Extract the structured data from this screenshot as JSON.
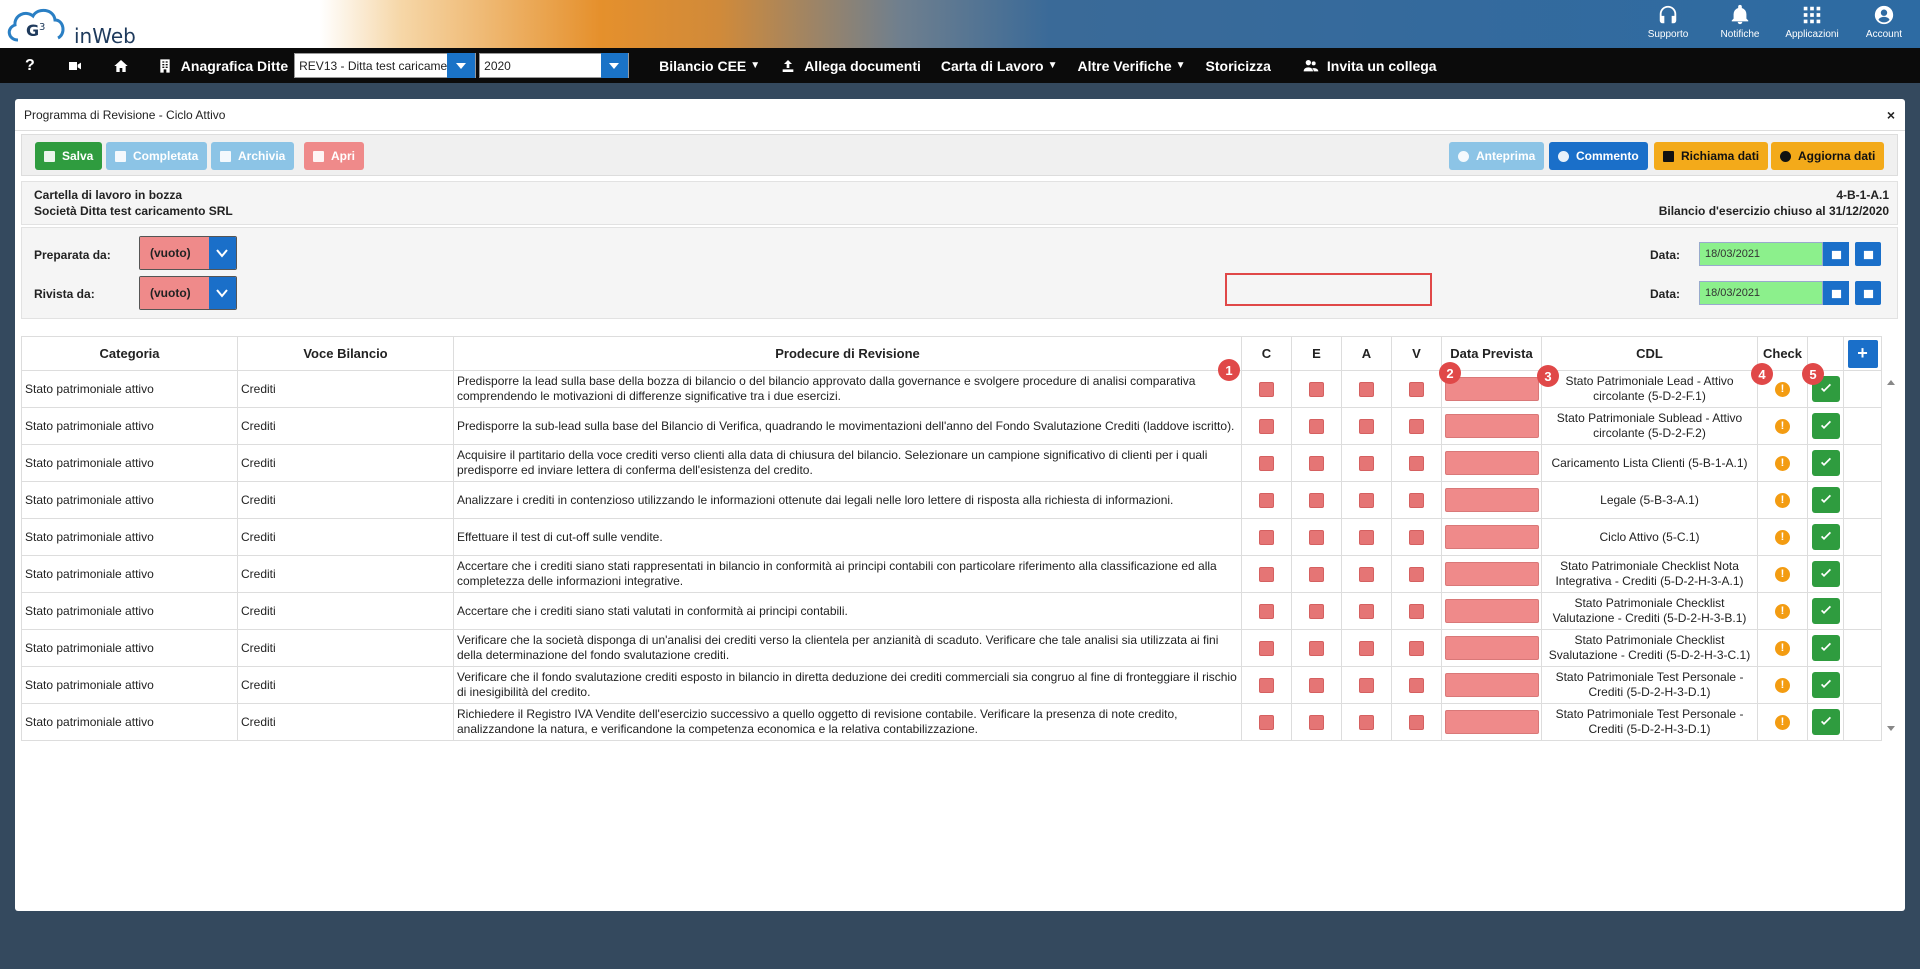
{
  "app": {
    "logo_text": "inWeb"
  },
  "top_icons": [
    {
      "label": "Supporto",
      "icon": "headset-icon"
    },
    {
      "label": "Notifiche",
      "icon": "bell-icon"
    },
    {
      "label": "Applicazioni",
      "icon": "grid-icon"
    },
    {
      "label": "Account",
      "icon": "user-icon"
    }
  ],
  "nav": {
    "anagrafica_label": "Anagrafica Ditte",
    "ditta_value": "REV13 - Ditta test caricame",
    "anno_value": "2020",
    "bilancio_cee": "Bilancio CEE",
    "allega_documenti": "Allega documenti",
    "carta_di_lavoro": "Carta di Lavoro",
    "altre_verifiche": "Altre Verifiche",
    "storicizza": "Storicizza",
    "invita_collega": "Invita un collega"
  },
  "panel": {
    "title": "Programma di Revisione - Ciclo Attivo",
    "close": "×"
  },
  "toolbar": {
    "salva": "Salva",
    "completata": "Completata",
    "archivia": "Archivia",
    "apri": "Apri",
    "anteprima": "Anteprima",
    "commento": "Commento",
    "richiama_dati": "Richiama dati",
    "aggiorna_dati": "Aggiorna dati"
  },
  "info": {
    "stato": "Cartella di lavoro in bozza",
    "societa": "Società Ditta test caricamento SRL",
    "codice": "4-B-1-A.1",
    "bilancio": "Bilancio d'esercizio chiuso al 31/12/2020"
  },
  "form": {
    "preparata_label": "Preparata da:",
    "preparata_value": "(vuoto)",
    "rivista_label": "Rivista da:",
    "rivista_value": "(vuoto)",
    "data_label": "Data:",
    "data1": "18/03/2021",
    "data2": "18/03/2021"
  },
  "table": {
    "headers": [
      "Categoria",
      "Voce Bilancio",
      "Prodecure di Revisione",
      "C",
      "E",
      "A",
      "V",
      "Data Prevista",
      "CDL",
      "Check",
      ""
    ],
    "rows": [
      {
        "cat": "Stato patrimoniale attivo",
        "voce": "Crediti",
        "proc": "Predisporre la lead sulla base della bozza di bilancio o del bilancio approvato dalla governance e svolgere procedure di analisi comparativa comprendendo le motivazioni di differenze significative tra i due esercizi.",
        "cdl": "Stato Patrimoniale Lead - Attivo circolante (5-D-2-F.1)"
      },
      {
        "cat": "Stato patrimoniale attivo",
        "voce": "Crediti",
        "proc": "Predisporre la sub-lead sulla base del Bilancio di Verifica, quadrando le movimentazioni dell'anno del Fondo Svalutazione Crediti (laddove iscritto).",
        "cdl": "Stato Patrimoniale Sublead - Attivo circolante (5-D-2-F.2)"
      },
      {
        "cat": "Stato patrimoniale attivo",
        "voce": "Crediti",
        "proc": "Acquisire il partitario della voce crediti verso clienti alla data di chiusura del bilancio. Selezionare un campione significativo di clienti per i quali predisporre ed inviare lettera di conferma dell'esistenza del credito.",
        "cdl": "Caricamento Lista Clienti (5-B-1-A.1)"
      },
      {
        "cat": "Stato patrimoniale attivo",
        "voce": "Crediti",
        "proc": "Analizzare i crediti in contenzioso utilizzando le informazioni ottenute dai legali nelle loro lettere di risposta alla richiesta di informazioni.",
        "cdl": "Legale (5-B-3-A.1)"
      },
      {
        "cat": "Stato patrimoniale attivo",
        "voce": "Crediti",
        "proc": "Effettuare il test di cut-off sulle vendite.",
        "cdl": "Ciclo Attivo (5-C.1)"
      },
      {
        "cat": "Stato patrimoniale attivo",
        "voce": "Crediti",
        "proc": "Accertare che i crediti siano stati rappresentati in bilancio in conformità ai principi contabili con particolare riferimento alla classificazione ed alla completezza delle informazioni integrative.",
        "cdl": "Stato Patrimoniale Checklist Nota Integrativa - Crediti (5-D-2-H-3-A.1)"
      },
      {
        "cat": "Stato patrimoniale attivo",
        "voce": "Crediti",
        "proc": "Accertare che i crediti siano stati valutati in conformità ai principi contabili.",
        "cdl": "Stato Patrimoniale Checklist Valutazione - Crediti (5-D-2-H-3-B.1)"
      },
      {
        "cat": "Stato patrimoniale attivo",
        "voce": "Crediti",
        "proc": "Verificare che la società disponga di un'analisi dei crediti verso la clientela per anzianità di scaduto. Verificare che tale analisi sia utilizzata ai fini della determinazione del fondo svalutazione crediti.",
        "cdl": "Stato Patrimoniale Checklist Svalutazione - Crediti (5-D-2-H-3-C.1)"
      },
      {
        "cat": "Stato patrimoniale attivo",
        "voce": "Crediti",
        "proc": "Verificare che il fondo svalutazione crediti esposto in bilancio in diretta deduzione dei crediti commerciali sia congruo al fine di fronteggiare il rischio di inesigibilità del credito.",
        "cdl": "Stato Patrimoniale Test Personale - Crediti (5-D-2-H-3-D.1)"
      },
      {
        "cat": "Stato patrimoniale attivo",
        "voce": "Crediti",
        "proc": "Richiedere il Registro IVA Vendite dell'esercizio successivo a quello oggetto di revisione contabile. Verificare la presenza di note credito, analizzandone la natura, e verificandone la competenza economica e la relativa contabilizzazione.",
        "cdl": "Stato Patrimoniale Test Personale - Crediti (5-D-2-H-3-D.1)"
      }
    ]
  },
  "badges": [
    "1",
    "2",
    "3",
    "4",
    "5"
  ],
  "colors": {
    "accent": "#1a6fc9",
    "success": "#2f9c3f",
    "danger": "#ef8a8a",
    "warning": "#f39c12"
  }
}
